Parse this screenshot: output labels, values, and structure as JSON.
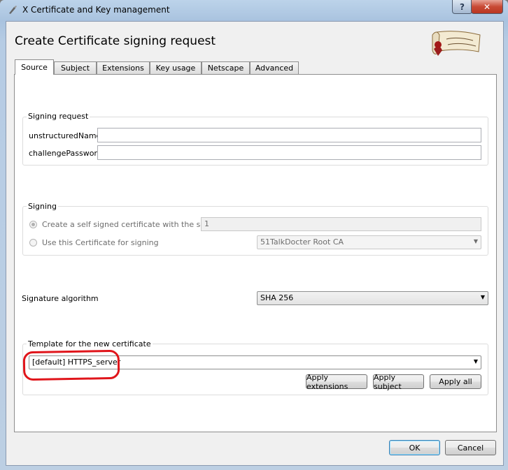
{
  "window": {
    "title": "X Certificate and Key management",
    "help": "?",
    "close": "✕"
  },
  "dialog": {
    "heading": "Create Certificate signing request"
  },
  "tabs": [
    {
      "label": "Source"
    },
    {
      "label": "Subject"
    },
    {
      "label": "Extensions"
    },
    {
      "label": "Key usage"
    },
    {
      "label": "Netscape"
    },
    {
      "label": "Advanced"
    }
  ],
  "signing_request": {
    "title": "Signing request",
    "unstructured_label": "unstructuredName",
    "unstructured_value": "",
    "challenge_label": "challengePassword",
    "challenge_value": ""
  },
  "signing": {
    "title": "Signing",
    "self_signed_label": "Create a self signed certificate with the serial",
    "serial_value": "1",
    "use_cert_label": "Use this Certificate for signing",
    "ca_value": "51TalkDocter Root CA"
  },
  "signature": {
    "label": "Signature algorithm",
    "value": "SHA 256"
  },
  "template": {
    "title": "Template for the new certificate",
    "value": "[default] HTTPS_server",
    "apply_extensions": "Apply extensions",
    "apply_subject": "Apply subject",
    "apply_all": "Apply all"
  },
  "footer": {
    "ok": "OK",
    "cancel": "Cancel"
  },
  "colors": {
    "highlight": "#e0151b",
    "close": "#c84a35"
  }
}
